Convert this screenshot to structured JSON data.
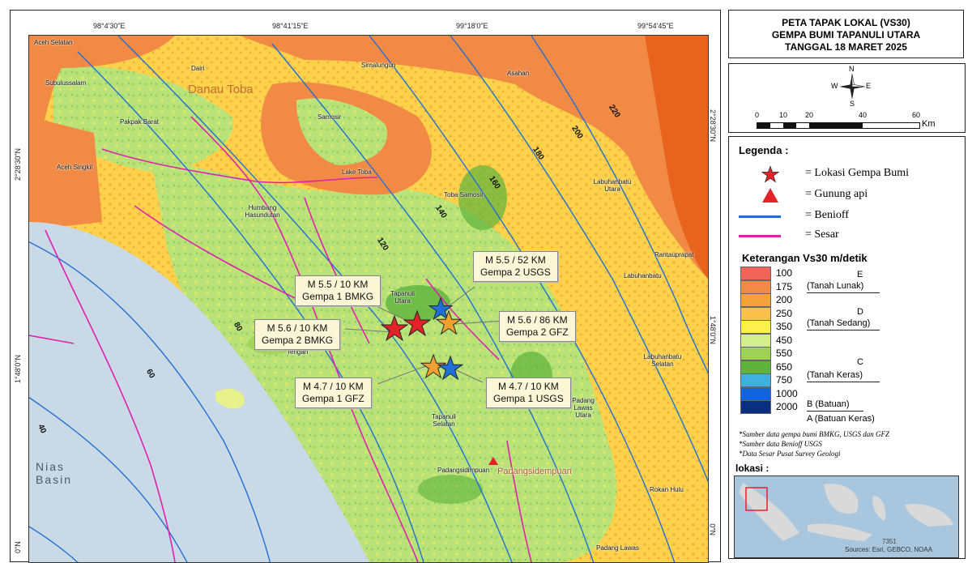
{
  "map": {
    "top_ticks": [
      "98°4'30\"E",
      "98°41'15\"E",
      "99°18'0\"E",
      "99°54'45\"E"
    ],
    "left_ticks": [
      "2°28'30\"N",
      "1°48'0\"N",
      "0\"N"
    ],
    "right_ticks": [
      "2°28'30\"N",
      "1°48'0\"N",
      "0\"N"
    ],
    "regions": [
      "Aceh Selatan",
      "Dairi",
      "Simalungun",
      "Asahan",
      "Subulussalam",
      "Pakpak Barat",
      "Samosir",
      "Aceh Singkil",
      "Lake Toba",
      "Labuhanbatu Utara",
      "Toba Samosir",
      "Humbang Hasundutan",
      "Rantauprapat",
      "Labuhanbatu",
      "Tapanuli Utara",
      "Tengah",
      "Labuhanbatu Selatan",
      "Padang Lawas Utara",
      "Tapanuli Selatan",
      "Padangsidimpuan",
      "Rokan Hulu",
      "Padang Lawas"
    ],
    "lake_label": "Danau Toba",
    "lake_label_2": "Padangsidempuan",
    "sea_label": "Nias Basin",
    "benioff_labels": [
      "40",
      "60",
      "80",
      "120",
      "140",
      "160",
      "180",
      "200",
      "220"
    ],
    "callouts": {
      "c1": "M 5.5 / 10 KM\nGempa 1 BMKG",
      "c2": "M 5.6 / 10 KM\nGempa 2 BMKG",
      "c3": "M 4.7 / 10 KM\nGempa 1 GFZ",
      "c4": "M 5.5 / 52 KM\nGempa 2 USGS",
      "c5": "M 5.6 / 86 KM\nGempa 2 GFZ",
      "c6": "M 4.7 / 10 KM\nGempa 1 USGS"
    }
  },
  "title": {
    "line1": "PETA TAPAK LOKAL (VS30)",
    "line2": "GEMPA BUMI TAPANULI UTARA",
    "line3": "TANGGAL 18 MARET 2025"
  },
  "compass": {
    "n": "N",
    "s": "S",
    "e": "E",
    "w": "W"
  },
  "scalebar": {
    "ticks": [
      "0",
      "10",
      "20",
      "40",
      "60"
    ],
    "unit": "Km"
  },
  "legend": {
    "title": "Legenda :",
    "items": [
      "= Lokasi Gempa Bumi",
      "= Gunung api",
      "= Benioff",
      "= Sesar"
    ],
    "vs30_title": "Keterangan Vs30 m/detik",
    "vs30_values": [
      "100",
      "175",
      "200",
      "250",
      "350",
      "450",
      "550",
      "650",
      "750",
      "1000",
      "2000"
    ],
    "vs30_colors": [
      "#f0645a",
      "#f08a45",
      "#f5a23c",
      "#f8c24a",
      "#fbf04c",
      "#d3ee8a",
      "#9fd154",
      "#5cb43c",
      "#3fb0e0",
      "#1064e0",
      "#0b2f80"
    ],
    "classes": {
      "e": "E",
      "e_desc": "(Tanah Lunak)",
      "d": "D",
      "d_desc": "(Tanah Sedang)",
      "c": "C",
      "c_desc": "(Tanah Keras)",
      "b": "B (Batuan)",
      "a": "A (Batuan Keras)"
    },
    "notes": [
      "*Sumber data gempa bumi BMKG, USGS dan GFZ",
      "*Sumber data Benioff USGS",
      "*Data Sesar Pusat Survey Geologi"
    ],
    "lokasi": "lokasi :",
    "inset_credit": "Sources: Esri, GEBCO, NOAA",
    "inset_num": "7351"
  },
  "colors": {
    "epicenter_red": "#e3222a",
    "epicenter_blue": "#1f6fd6",
    "epicenter_orange": "#f0a030",
    "benioff": "#1f6fd6",
    "sesar": "#e020b0",
    "volcano": "#e3222a"
  }
}
